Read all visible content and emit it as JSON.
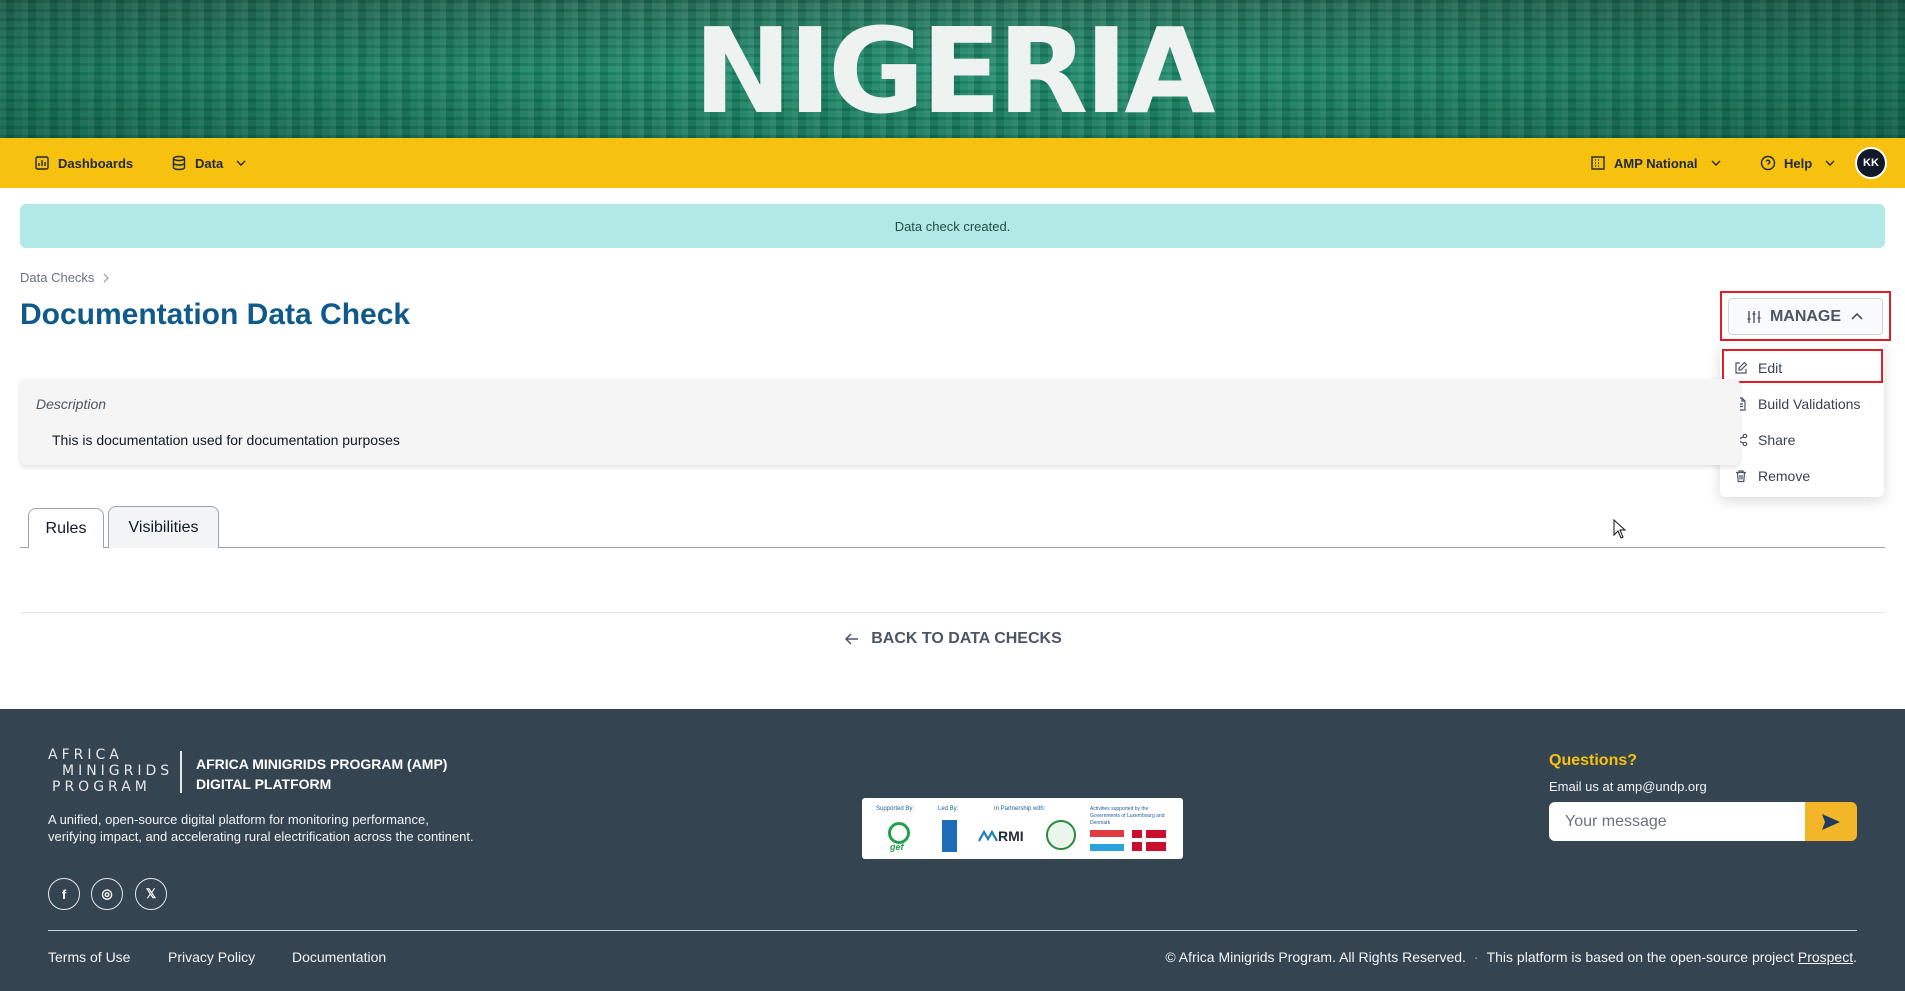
{
  "banner": {
    "title": "NIGERIA"
  },
  "nav": {
    "dashboards": "Dashboards",
    "data": "Data",
    "org": "AMP National",
    "help": "Help",
    "avatar": "KK"
  },
  "alert": {
    "message": "Data check created."
  },
  "breadcrumb": {
    "item": "Data Checks"
  },
  "page": {
    "title": "Documentation Data Check"
  },
  "manage": {
    "label": "MANAGE",
    "menu": [
      {
        "label": "Edit",
        "icon": "edit-icon"
      },
      {
        "label": "Build Validations",
        "icon": "document-icon"
      },
      {
        "label": "Share",
        "icon": "share-icon"
      },
      {
        "label": "Remove",
        "icon": "trash-icon"
      }
    ]
  },
  "description": {
    "label": "Description",
    "text": "This is documentation used for documentation purposes"
  },
  "tabs": [
    {
      "label": "Rules",
      "active": true
    },
    {
      "label": "Visibilities",
      "active": false
    }
  ],
  "back": {
    "label": "BACK TO DATA CHECKS"
  },
  "footer": {
    "logo_lines": [
      "AFRICA",
      "MINIGRIDS",
      "PROGRAM"
    ],
    "logo_title_line1": "AFRICA MINIGRIDS PROGRAM (AMP)",
    "logo_title_line2": "DIGITAL PLATFORM",
    "description": "A unified, open-source digital platform for monitoring performance, verifying impact, and accelerating rural electrification across the continent.",
    "social": [
      "f",
      "◎",
      "𝕏"
    ],
    "partners": {
      "supported_by": "Supported By:",
      "led_by": "Led By:",
      "in_partnership": "In Partnership with:",
      "activities": "Activities supported by the Governments of Luxembourg and Denmark",
      "gef": "gef",
      "rmi": "RMI"
    },
    "questions": "Questions?",
    "email": "Email us at amp@undp.org",
    "message_placeholder": "Your message",
    "links": [
      "Terms of Use",
      "Privacy Policy",
      "Documentation"
    ],
    "copyright": "© Africa Minigrids Program. All Rights Reserved.",
    "platform_note": "This platform is based on the open-source project",
    "prospect": "Prospect",
    "period": "."
  },
  "colors": {
    "nav": "#f7c10f",
    "title": "#0f5a8a",
    "footer": "#344450",
    "alert": "#b2e8e5",
    "highlight": "#e11d2a"
  }
}
